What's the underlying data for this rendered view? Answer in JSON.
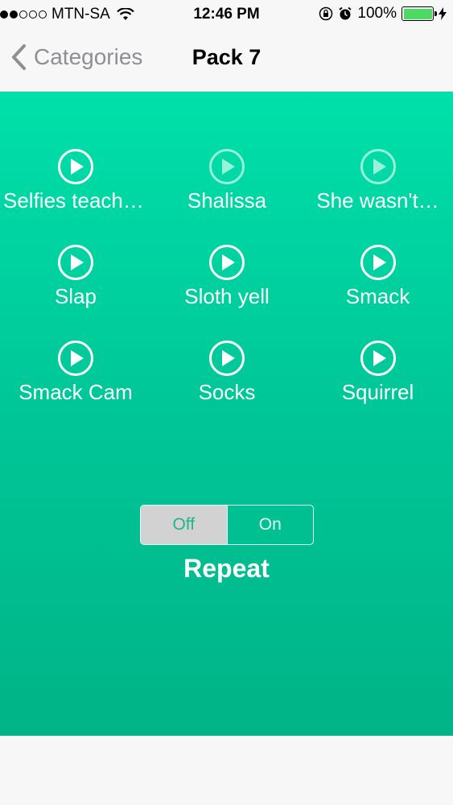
{
  "status_bar": {
    "carrier": "MTN-SA",
    "time": "12:46 PM",
    "battery_percent": "100%",
    "signal_dots_filled": 2,
    "signal_dots_total": 5,
    "battery_level": 1.0,
    "battery_color": "#4cd964"
  },
  "nav": {
    "back_label": "Categories",
    "title": "Pack 7"
  },
  "sounds": [
    {
      "label": "Selfies teachers",
      "icon": "play-circle-icon"
    },
    {
      "label": "Shalissa",
      "icon": "play-circle-icon"
    },
    {
      "label": "She wasn't…",
      "icon": "play-circle-icon"
    },
    {
      "label": "Slap",
      "icon": "play-circle-icon"
    },
    {
      "label": "Sloth yell",
      "icon": "play-circle-icon"
    },
    {
      "label": "Smack",
      "icon": "play-circle-icon"
    },
    {
      "label": "Smack Cam",
      "icon": "play-circle-icon"
    },
    {
      "label": "Socks",
      "icon": "play-circle-icon"
    },
    {
      "label": "Squirrel",
      "icon": "play-circle-icon"
    }
  ],
  "repeat": {
    "off_label": "Off",
    "on_label": "On",
    "selected": "Off",
    "label": "Repeat"
  },
  "colors": {
    "accent_top": "#00e0aa",
    "accent_bottom": "#00b487",
    "nav_back": "#8e8e93"
  }
}
